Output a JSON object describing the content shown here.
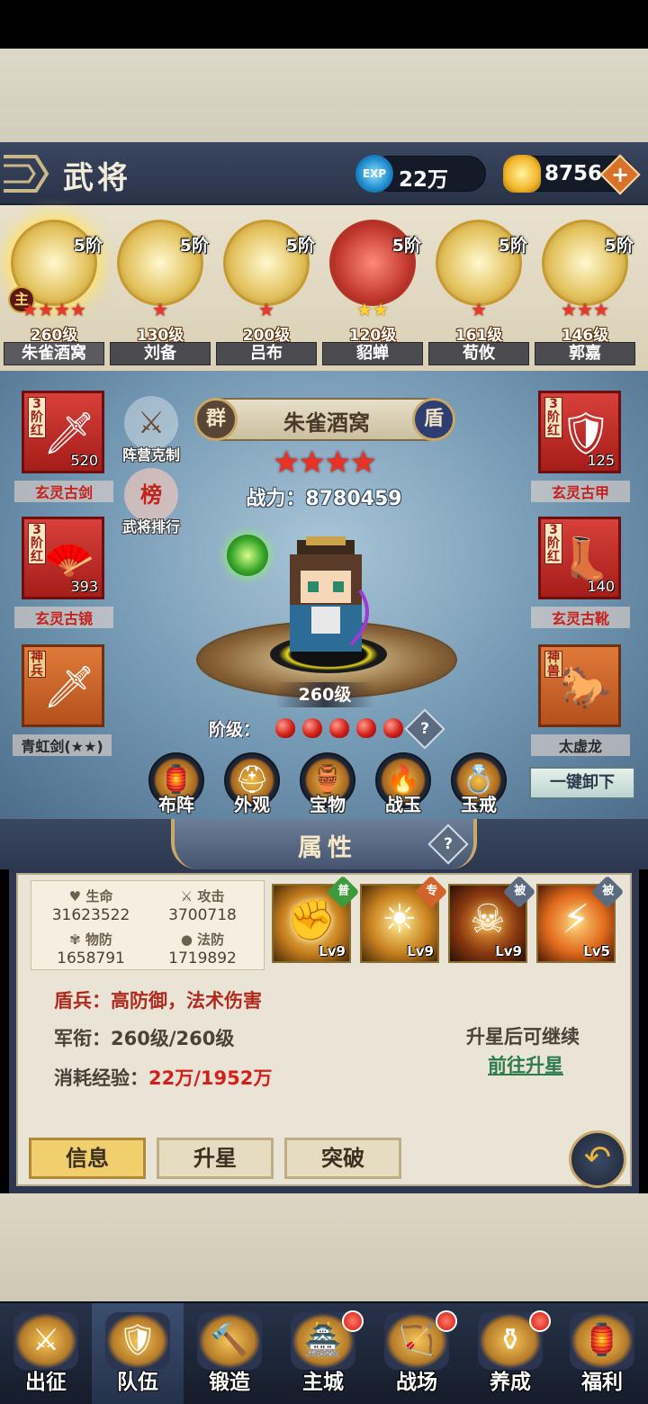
{
  "header": {
    "title": "武将",
    "exp_value": "22万",
    "exp_icon_text": "EXP",
    "gold_value": "8756",
    "add_icon": "plus-icon"
  },
  "roster": [
    {
      "tier": "5阶",
      "stars": "★★★★",
      "star_color": "red",
      "level": "260级",
      "name": "朱雀酒窝",
      "selected": true,
      "main_badge": "主"
    },
    {
      "tier": "5阶",
      "stars": "★",
      "star_color": "red",
      "level": "130级",
      "name": "刘备"
    },
    {
      "tier": "5阶",
      "stars": "★",
      "star_color": "red",
      "level": "200级",
      "name": "吕布"
    },
    {
      "tier": "5阶",
      "stars": "★★",
      "star_color": "gold",
      "level": "120级",
      "name": "貂蝉",
      "red_frame": true
    },
    {
      "tier": "5阶",
      "stars": "★",
      "star_color": "red",
      "level": "161级",
      "name": "荀攸"
    },
    {
      "tier": "5阶",
      "stars": "★★★",
      "star_color": "red",
      "level": "146级",
      "name": "郭嘉"
    }
  ],
  "equipment": {
    "left": [
      {
        "rank": "3\n阶\n红",
        "count": "520",
        "label": "玄灵古剑",
        "icon": "sword-icon"
      },
      {
        "rank": "3\n阶\n红",
        "count": "393",
        "label": "玄灵古镜",
        "icon": "fan-icon"
      },
      {
        "rank": "神\n兵",
        "count": "",
        "label": "青虹剑(★★)",
        "icon": "divine-sword-icon"
      }
    ],
    "right": [
      {
        "rank": "3\n阶\n红",
        "count": "125",
        "label": "玄灵古甲",
        "icon": "armor-icon"
      },
      {
        "rank": "3\n阶\n红",
        "count": "140",
        "label": "玄灵古靴",
        "icon": "boots-icon"
      },
      {
        "rank": "神\n兽",
        "count": "",
        "label": "太虚龙",
        "icon": "horse-icon"
      }
    ]
  },
  "side_buttons": {
    "restraint": "阵营克制",
    "ranking": "武将排行",
    "ranking_icon_text": "榜"
  },
  "hero": {
    "faction": "群",
    "type": "盾",
    "name": "朱雀酒窝",
    "stars": "★★★★",
    "power_label": "战力：",
    "power_value": "8780459",
    "level": "260级",
    "rank_label": "阶级：",
    "rank_gems": 5,
    "help": "?"
  },
  "functions": [
    "布阵",
    "外观",
    "宝物",
    "战玉",
    "玉戒"
  ],
  "unequip_all": "一键卸下",
  "attributes": {
    "title": "属性",
    "help": "?",
    "hp_label": "生命",
    "hp": "31623522",
    "atk_label": "攻击",
    "atk": "3700718",
    "pdef_label": "物防",
    "pdef": "1658791",
    "mdef_label": "法防",
    "mdef": "1719892"
  },
  "skills": [
    {
      "tag": "普",
      "tag_color": "#3e9a3a",
      "level": "Lv9",
      "icon": "fist-icon"
    },
    {
      "tag": "专",
      "tag_color": "#d0642a",
      "level": "Lv9",
      "icon": "warrior-icon"
    },
    {
      "tag": "被",
      "tag_color": "#5b6b80",
      "level": "Lv9",
      "icon": "mask-icon"
    },
    {
      "tag": "被",
      "tag_color": "#5b6b80",
      "level": "Lv5",
      "icon": "lightning-icon"
    }
  ],
  "info": {
    "type_desc": "盾兵：高防御，法术伤害",
    "rank_label": "军衔：",
    "rank_value": "260级/260级",
    "exp_label": "消耗经验：",
    "exp_value": "22万/1952万",
    "hint": "升星后可继续",
    "link": "前往升星"
  },
  "tabs": [
    "信息",
    "升星",
    "突破"
  ],
  "nav": [
    {
      "label": "出征",
      "dot": false
    },
    {
      "label": "队伍",
      "dot": false,
      "active": true
    },
    {
      "label": "锻造",
      "dot": false
    },
    {
      "label": "主城",
      "dot": true
    },
    {
      "label": "战场",
      "dot": true
    },
    {
      "label": "养成",
      "dot": true
    },
    {
      "label": "福利",
      "dot": false
    }
  ],
  "colors": {
    "accent_gold": "#f1cf6c",
    "star_red": "#e8382a",
    "value_red": "#d4201a",
    "link_green": "#2e7a4e"
  }
}
